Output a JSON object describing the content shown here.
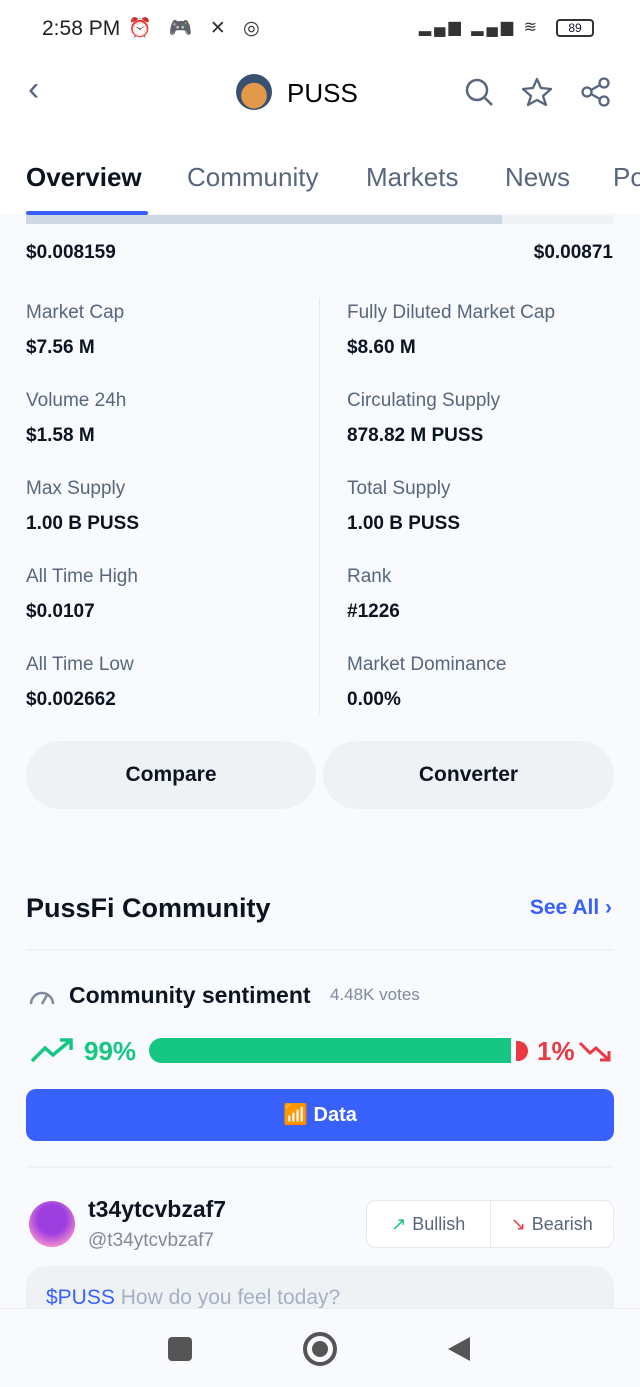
{
  "status": {
    "time": "2:58 PM",
    "icons": "⏰ 🎮 ✕ ◎",
    "signal": "▂▄▆ ▂▄▆ ≋",
    "battery": "89"
  },
  "header": {
    "title": "PUSS"
  },
  "tabs": [
    "Overview",
    "Community",
    "Markets",
    "News",
    "Po"
  ],
  "range": {
    "low": "$0.008159",
    "high": "$0.00871",
    "position": 0.81
  },
  "stats": [
    {
      "label": "Market Cap",
      "value": "$7.56 M"
    },
    {
      "label": "Fully Diluted Market Cap",
      "value": "$8.60 M"
    },
    {
      "label": "Volume 24h",
      "value": "$1.58 M"
    },
    {
      "label": "Circulating Supply",
      "value": "878.82 M PUSS"
    },
    {
      "label": "Max Supply",
      "value": "1.00 B PUSS"
    },
    {
      "label": "Total Supply",
      "value": "1.00 B PUSS"
    },
    {
      "label": "All Time High",
      "value": "$0.0107"
    },
    {
      "label": "Rank",
      "value": "#1226"
    },
    {
      "label": "All Time Low",
      "value": "$0.002662"
    },
    {
      "label": "Market Dominance",
      "value": "0.00%"
    }
  ],
  "buttons": {
    "compare": "Compare",
    "converter": "Converter"
  },
  "community": {
    "title": "PussFi Community",
    "see_all": "See All",
    "sentiment": "Community sentiment",
    "votes": "4.48K votes",
    "bullish_pct": "99%",
    "bearish_pct": "1%",
    "data": "Data"
  },
  "post": {
    "username": "t34ytcvbzaf7",
    "handle": "@t34ytcvbzaf7",
    "bullish": "Bullish",
    "bearish": "Bearish",
    "ticker": "$PUSS",
    "placeholder": "How do you feel today?"
  },
  "colors": {
    "accent": "#3861fb",
    "bull": "#16c784",
    "bear": "#ea3943"
  }
}
